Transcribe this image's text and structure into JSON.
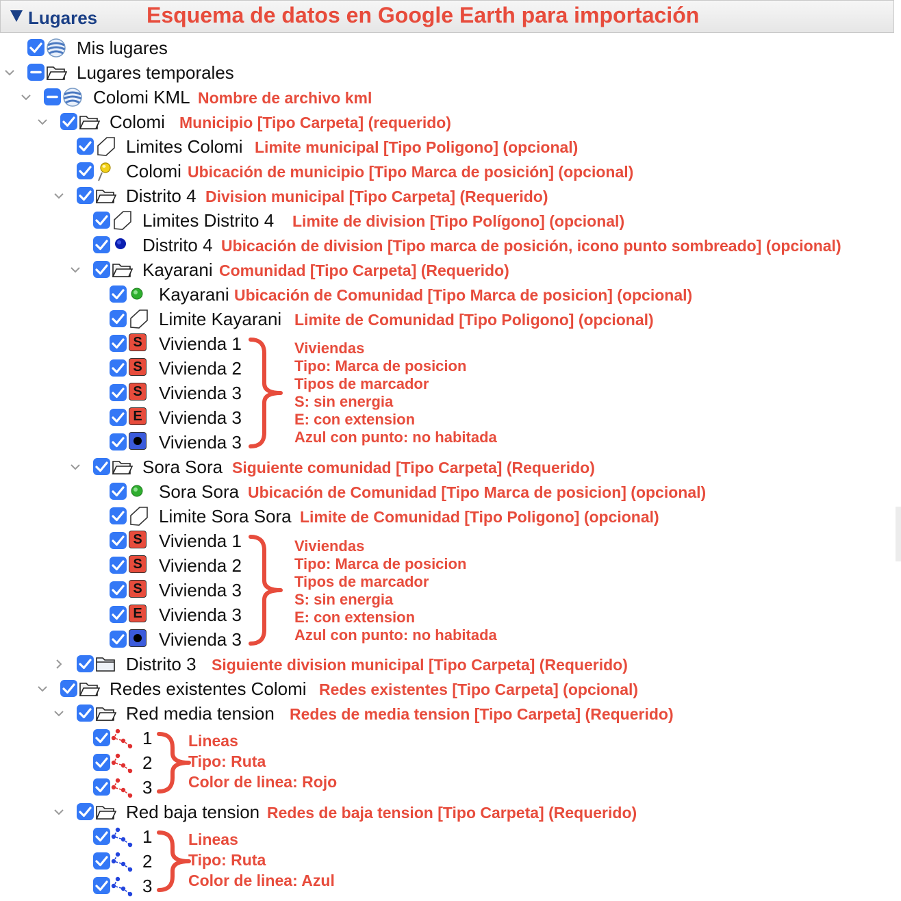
{
  "panel": {
    "title": "Lugares",
    "heading": "Esquema de datos en Google Earth para importación"
  },
  "tree": {
    "mis_lugares": "Mis lugares",
    "lugares_temporales": "Lugares temporales",
    "colomi_kml": {
      "label": "Colomi KML",
      "note": "Nombre de archivo kml"
    },
    "colomi_folder": {
      "label": "Colomi",
      "note": "Municipio [Tipo Carpeta] (requerido)"
    },
    "limites_colomi": {
      "label": "Limites Colomi",
      "note": "Limite municipal [Tipo Poligono] (opcional)"
    },
    "colomi_pin": {
      "label": "Colomi",
      "note": "Ubicación de municipio [Tipo Marca de posición] (opcional)"
    },
    "distrito4": {
      "label": "Distrito 4",
      "note": "Division municipal [Tipo Carpeta] (Requerido)"
    },
    "limites_distrito4": {
      "label": "Limites Distrito 4",
      "note": "Limite de division [Tipo Polígono] (opcional)"
    },
    "distrito4_pin": {
      "label": "Distrito 4",
      "note": "Ubicación de division [Tipo marca de posición, icono punto sombreado] (opcional)"
    },
    "kayarani": {
      "label": "Kayarani",
      "note": "Comunidad [Tipo Carpeta] (Requerido)"
    },
    "kayarani_pin": {
      "label": "Kayarani",
      "note": "Ubicación de Comunidad [Tipo Marca de posicion] (opcional)"
    },
    "limite_kayarani": {
      "label": "Limite Kayarani",
      "note": "Limite de Comunidad [Tipo Poligono] (opcional)"
    },
    "sora_sora": {
      "label": "Sora Sora",
      "note": "Siguiente comunidad [Tipo Carpeta] (Requerido)"
    },
    "sora_sora_pin": {
      "label": "Sora Sora",
      "note": "Ubicación de Comunidad [Tipo Marca de posicion] (opcional)"
    },
    "limite_sora_sora": {
      "label": "Limite Sora Sora",
      "note": "Limite de Comunidad [Tipo Poligono] (opcional)"
    },
    "distrito3": {
      "label": "Distrito 3",
      "note": "Siguiente division municipal [Tipo Carpeta] (Requerido)"
    },
    "redes": {
      "label": "Redes existentes Colomi",
      "note": "Redes existentes [Tipo Carpeta] (opcional)"
    },
    "red_media": {
      "label": "Red media tension",
      "note": "Redes de media tension [Tipo Carpeta] (Requerido)"
    },
    "red_baja": {
      "label": "Red baja tension",
      "note": "Redes de baja tension [Tipo Carpeta] (Requerido)"
    }
  },
  "viviendas_kayarani": [
    {
      "badge": "S",
      "label": "Vivienda 1"
    },
    {
      "badge": "S",
      "label": "Vivienda 2"
    },
    {
      "badge": "S",
      "label": "Vivienda 3"
    },
    {
      "badge": "E",
      "label": "Vivienda 3"
    },
    {
      "badge": "",
      "label": "Vivienda 3"
    }
  ],
  "viviendas_sora": [
    {
      "badge": "S",
      "label": "Vivienda 1"
    },
    {
      "badge": "S",
      "label": "Vivienda 2"
    },
    {
      "badge": "S",
      "label": "Vivienda 3"
    },
    {
      "badge": "E",
      "label": "Vivienda 3"
    },
    {
      "badge": "",
      "label": "Vivienda 3"
    }
  ],
  "viviendas_note": [
    "Viviendas",
    "Tipo: Marca de posicion",
    "Tipos de marcador",
    "S: sin energia",
    "E: con extension",
    "Azul con punto: no habitada"
  ],
  "lineas_media": {
    "items": [
      "1",
      "2",
      "3"
    ],
    "note": [
      "Lineas",
      "Tipo: Ruta",
      "Color de linea: Rojo"
    ]
  },
  "lineas_baja": {
    "items": [
      "1",
      "2",
      "3"
    ],
    "note": [
      "Lineas",
      "Tipo: Ruta",
      "Color de linea: Azul"
    ]
  },
  "colors": {
    "accent": "#e74c3c",
    "checkbox": "#3478f6",
    "title": "#1a3f86",
    "red_line": "#e03030",
    "blue_line": "#2244dd"
  }
}
